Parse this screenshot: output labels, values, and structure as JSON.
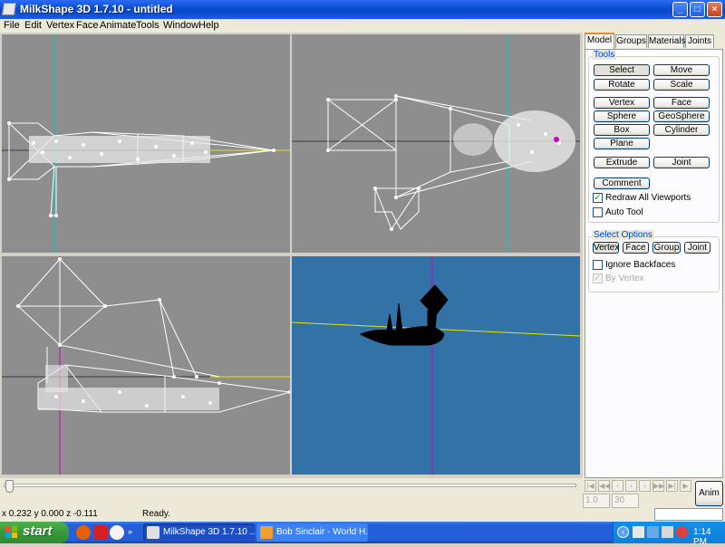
{
  "window": {
    "title": "MilkShape 3D 1.7.10 - untitled"
  },
  "menu": [
    "File",
    "Edit",
    "Vertex",
    "Face",
    "Animate",
    "Tools",
    "Window",
    "Help"
  ],
  "tabs": [
    "Model",
    "Groups",
    "Materials",
    "Joints"
  ],
  "tools": {
    "label": "Tools",
    "select": "Select",
    "move": "Move",
    "rotate": "Rotate",
    "scale": "Scale",
    "vertex": "Vertex",
    "face": "Face",
    "sphere": "Sphere",
    "geosphere": "GeoSphere",
    "box": "Box",
    "cylinder": "Cylinder",
    "plane": "Plane",
    "extrude": "Extrude",
    "joint": "Joint",
    "comment": "Comment",
    "redraw": "Redraw All Viewports",
    "autotool": "Auto Tool",
    "redraw_checked": true,
    "autotool_checked": false
  },
  "select_options": {
    "label": "Select Options",
    "vertex": "Vertex",
    "face": "Face",
    "group": "Group",
    "joint": "Joint",
    "ignore_backfaces": "Ignore Backfaces",
    "by_vertex": "By Vertex",
    "ignore_checked": false,
    "by_vertex_checked": true
  },
  "animation": {
    "start_frame": "1.0",
    "end_frame": "30",
    "anim_button": "Anim"
  },
  "status": {
    "coords": "x 0.232 y 0.000 z -0.111",
    "message": "Ready."
  },
  "taskbar": {
    "start": "start",
    "items": [
      "MilkShape 3D 1.7.10 ...",
      "Bob Sinclair - World H..."
    ],
    "clock": "1:14 PM"
  },
  "colors": {
    "viewport_gray": "#8e8e8e",
    "viewport_3d": "#3272a6",
    "axis_cyan": "#00c8c8",
    "axis_yellow": "#e6e600",
    "axis_magenta": "#c800c8"
  }
}
